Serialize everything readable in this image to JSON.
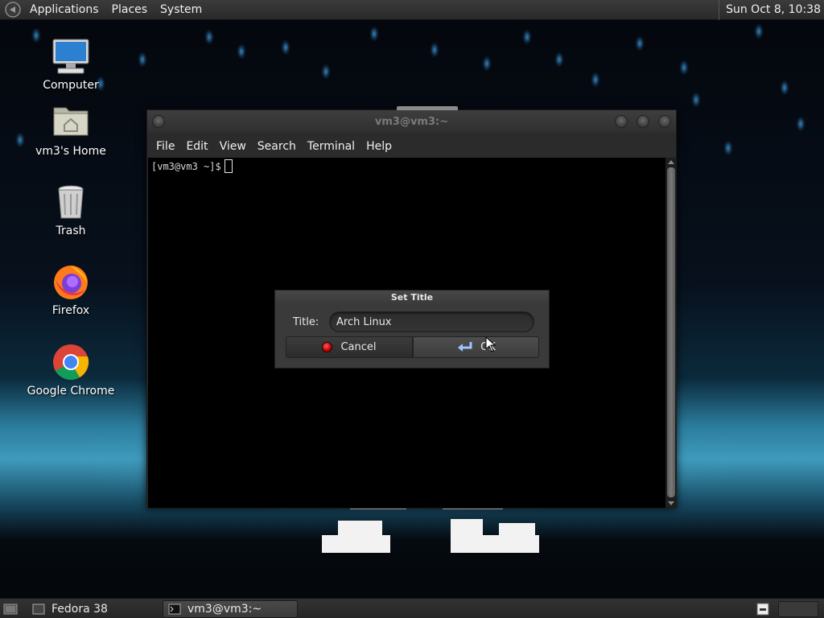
{
  "top_panel": {
    "menus": [
      "Applications",
      "Places",
      "System"
    ],
    "clock": "Sun Oct  8, 10:38",
    "logo_icon": "gnome-foot-icon"
  },
  "desktop_icons": [
    {
      "label": "Computer",
      "icon": "computer-icon"
    },
    {
      "label": "vm3's Home",
      "icon": "home-folder-icon"
    },
    {
      "label": "Trash",
      "icon": "trash-icon"
    },
    {
      "label": "Firefox",
      "icon": "firefox-icon"
    },
    {
      "label": "Google Chrome",
      "icon": "chrome-icon"
    }
  ],
  "terminal": {
    "title": "vm3@vm3:~",
    "menus": [
      "File",
      "Edit",
      "View",
      "Search",
      "Terminal",
      "Help"
    ],
    "prompt": "[vm3@vm3 ~]$"
  },
  "dialog": {
    "title": "Set Title",
    "field_label": "Title:",
    "field_value": "Arch Linux",
    "cancel_label": "Cancel",
    "ok_label": "OK"
  },
  "bottom_panel": {
    "tasks": [
      {
        "label": "Fedora 38",
        "active": false
      },
      {
        "label": "vm3@vm3:~",
        "active": true
      }
    ]
  },
  "colors": {
    "panel_bg": "#2f2f2f",
    "terminal_bg": "#000000",
    "dialog_bg": "#3a3a3a",
    "cancel_red": "#d10000"
  }
}
